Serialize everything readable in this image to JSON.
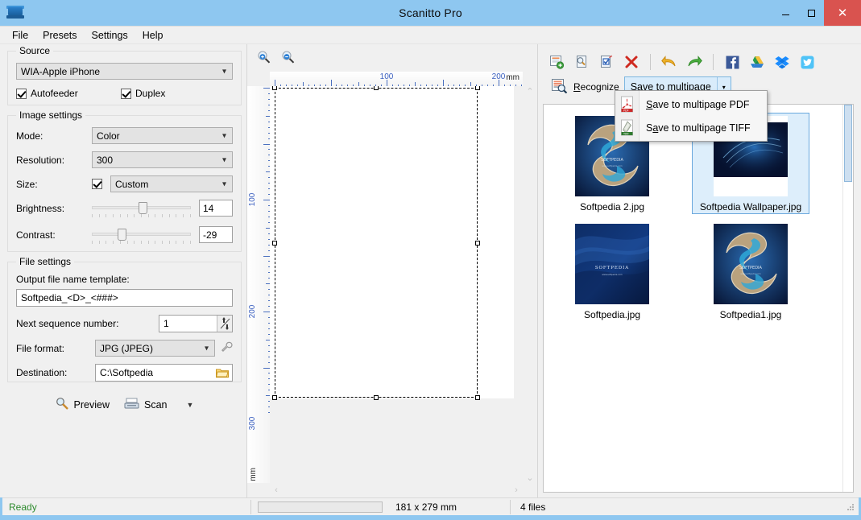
{
  "window": {
    "title": "Scanitto Pro",
    "app_icon": "scanner-icon",
    "minimize": "–",
    "maximize": "☐",
    "close": "✕",
    "titlebar_color": "#8ec7f0",
    "close_color": "#d9534f"
  },
  "menubar": {
    "items": [
      {
        "label": "File"
      },
      {
        "label": "Presets"
      },
      {
        "label": "Settings"
      },
      {
        "label": "Help"
      }
    ]
  },
  "left_panel": {
    "source": {
      "legend": "Source",
      "device_value": "WIA-Apple iPhone",
      "autofeeder_label": "Autofeeder",
      "autofeeder_checked": true,
      "duplex_label": "Duplex",
      "duplex_checked": true
    },
    "image_settings": {
      "legend": "Image settings",
      "mode_label": "Mode:",
      "mode_value": "Color",
      "resolution_label": "Resolution:",
      "resolution_value": "300",
      "size_label": "Size:",
      "size_checked": true,
      "size_value": "Custom",
      "brightness_label": "Brightness:",
      "brightness_value": "14",
      "contrast_label": "Contrast:",
      "contrast_value": "-29"
    },
    "file_settings": {
      "legend": "File settings",
      "template_label": "Output file name template:",
      "template_value": "Softpedia_<D>_<###>",
      "sequence_label": "Next sequence number:",
      "sequence_value": "1",
      "format_label": "File format:",
      "format_value": "JPG (JPEG)",
      "format_settings_icon": "wrench-icon",
      "destination_label": "Destination:",
      "destination_value": "C:\\Softpedia",
      "browse_icon": "folder-icon"
    },
    "actions": {
      "preview_label": "Preview",
      "preview_icon": "magnifier-icon",
      "scan_label": "Scan",
      "scan_icon": "scanner-icon",
      "scan_caret": "▼"
    }
  },
  "center_panel": {
    "zoom_in_icon": "zoom-in-icon",
    "zoom_out_icon": "zoom-out-icon",
    "ruler_unit": "mm",
    "ruler_h_labels": [
      "100",
      "200"
    ],
    "ruler_v_labels": [
      "100",
      "200",
      "300"
    ],
    "scroll_up": "⌃",
    "scroll_down": "⌄",
    "scroll_left": "‹",
    "scroll_right": "›"
  },
  "right_panel": {
    "toolbar": [
      {
        "name": "add-document-icon",
        "title": "Add"
      },
      {
        "name": "preview-document-icon",
        "title": "Preview"
      },
      {
        "name": "edit-document-icon",
        "title": "Edit"
      },
      {
        "name": "delete-icon",
        "title": "Delete"
      },
      {
        "name": "undo-icon",
        "title": "Undo"
      },
      {
        "name": "redo-icon",
        "title": "Redo"
      },
      {
        "name": "facebook-icon",
        "title": "Facebook"
      },
      {
        "name": "google-drive-icon",
        "title": "Google Drive"
      },
      {
        "name": "dropbox-icon",
        "title": "Dropbox"
      },
      {
        "name": "twitter-icon",
        "title": "Twitter"
      }
    ],
    "recognize_label": "Recognize",
    "recognize_accel": "R",
    "recognize_icon": "ocr-icon",
    "save_multipage_label": "Save to multipage",
    "save_multipage_caret": "▾",
    "dropdown": {
      "items": [
        {
          "label": "Save to multipage PDF",
          "icon": "pdf-icon"
        },
        {
          "label": "Save to multipage TIFF",
          "icon": "tiff-icon"
        }
      ]
    },
    "thumbnails": [
      {
        "caption": "Softpedia 2.jpg",
        "selected": false,
        "style": "s-island"
      },
      {
        "caption": "Softpedia Wallpaper.jpg",
        "selected": true,
        "style": "wallpaper-dark"
      },
      {
        "caption": "Softpedia.jpg",
        "selected": false,
        "style": "wallpaper-blue"
      },
      {
        "caption": "Softpedia1.jpg",
        "selected": false,
        "style": "s-island"
      }
    ]
  },
  "statusbar": {
    "ready_text": "Ready",
    "ready_color": "#2e8b2e",
    "dimensions": "181 x 279 mm",
    "files_count": "4 files"
  }
}
